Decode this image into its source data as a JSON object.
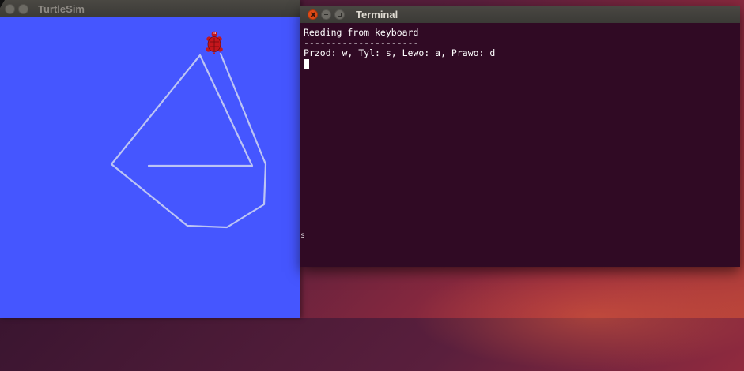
{
  "turtlesim": {
    "title": "TurtleSim",
    "background_color": "#4556ff",
    "trail_color": "#bcc4f4",
    "turtle_icon": "turtle-icon"
  },
  "terminal": {
    "title": "Terminal",
    "background_color": "#300a24",
    "lines": [
      "Reading from keyboard",
      "---------------------",
      "Przod: w, Tyl: s, Lewo: a, Prawo: d"
    ],
    "side_glyph": "s"
  }
}
